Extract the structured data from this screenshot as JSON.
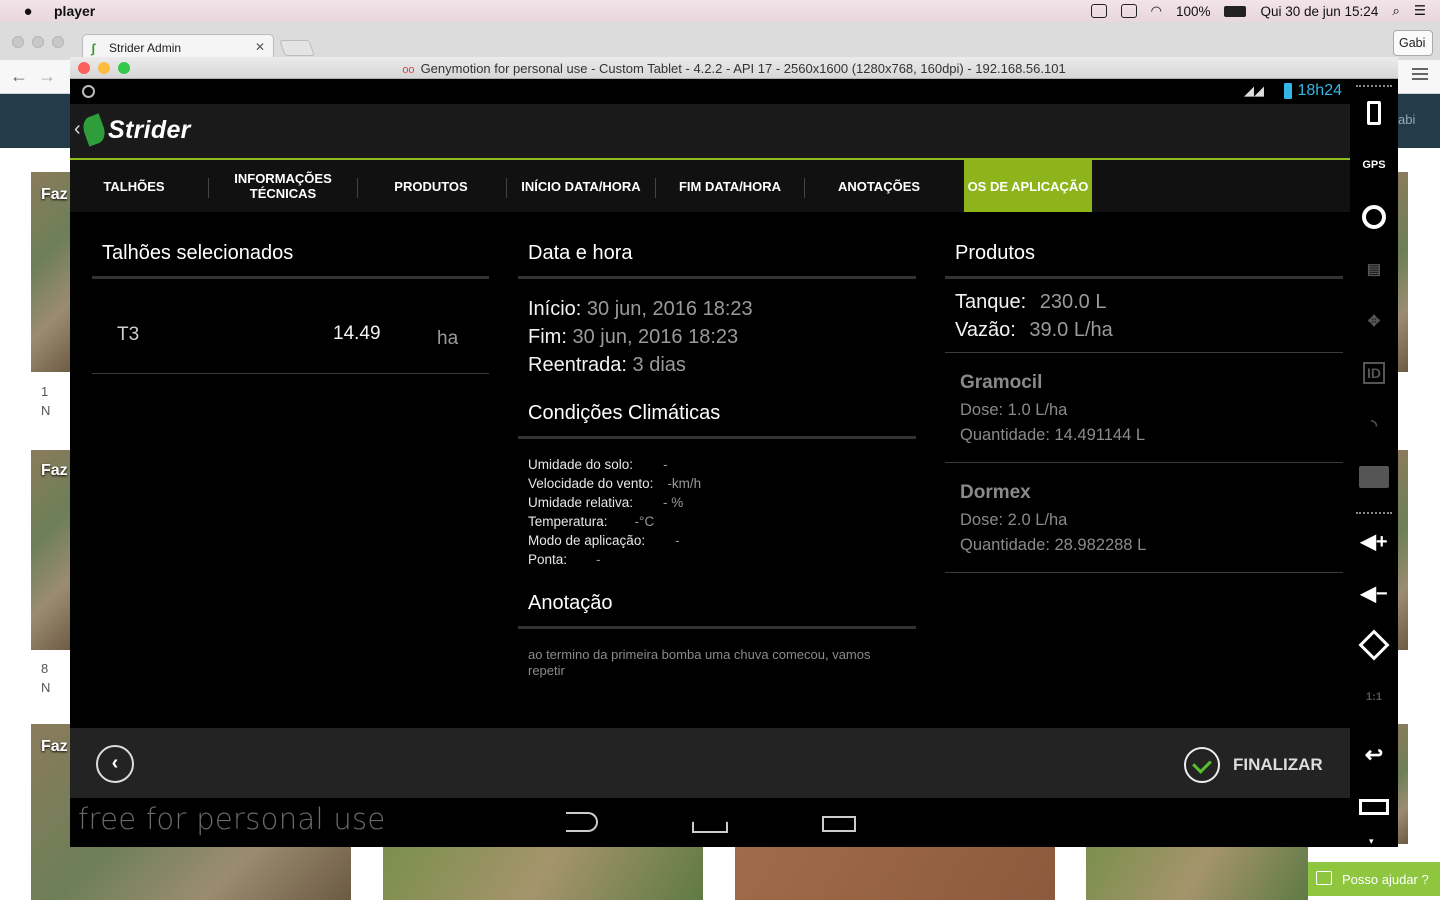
{
  "mac_menubar": {
    "app_name": "player",
    "battery_pct": "100%",
    "datetime": "Qui 30 de jun  15:24"
  },
  "browser": {
    "tab_title": "Strider Admin",
    "profile": "Gabi",
    "header_user_fragment": "abi",
    "help_button": "Posso ajudar ?",
    "cards": [
      {
        "label": "Faz",
        "meta1": "1",
        "meta2": "N"
      },
      {
        "label": "Faz",
        "meta1": "8",
        "meta2": "N"
      },
      {
        "label": "Faz"
      }
    ]
  },
  "genymotion": {
    "window_title": "Genymotion for personal use - Custom Tablet - 4.2.2 - API 17 - 2560x1600 (1280x768, 160dpi) - 192.168.56.101",
    "watermark": "free for personal use"
  },
  "android_status": {
    "time": "18h24"
  },
  "app": {
    "title": "Strider",
    "tabs": [
      {
        "label": "TALHÕES"
      },
      {
        "label": "INFORMAÇÕES TÉCNICAS"
      },
      {
        "label": "PRODUTOS"
      },
      {
        "label": "INÍCIO DATA/HORA"
      },
      {
        "label": "FIM DATA/HORA"
      },
      {
        "label": "ANOTAÇÕES"
      },
      {
        "label": "OS DE APLICAÇÃO"
      }
    ],
    "active_tab": "OS DE APLICAÇÃO",
    "talhoes": {
      "heading": "Talhões selecionados",
      "rows": [
        {
          "name": "T3",
          "area": "14.49",
          "unit": "ha"
        }
      ]
    },
    "data_hora": {
      "heading": "Data e hora",
      "inicio_label": "Início:",
      "inicio_value": "30 jun, 2016 18:23",
      "fim_label": "Fim:",
      "fim_value": "30 jun, 2016 18:23",
      "reentrada_label": "Reentrada:",
      "reentrada_value": "3 dias"
    },
    "clima": {
      "heading": "Condições Climáticas",
      "rows": [
        {
          "label": "Umidade do solo:",
          "value": "-"
        },
        {
          "label": "Velocidade do vento:",
          "value": "-km/h"
        },
        {
          "label": "Umidade relativa:",
          "value": "- %"
        },
        {
          "label": "Temperatura:",
          "value": "-°C"
        },
        {
          "label": "Modo de aplicação:",
          "value": "-"
        },
        {
          "label": "Ponta:",
          "value": "-"
        }
      ]
    },
    "anotacao": {
      "heading": "Anotação",
      "text": "ao termino da primeira bomba uma chuva comecou, vamos repetir"
    },
    "produtos": {
      "heading": "Produtos",
      "tanque_label": "Tanque:",
      "tanque_value": "230.0 L",
      "vazao_label": "Vazão:",
      "vazao_value": "39.0 L/ha",
      "items": [
        {
          "name": "Gramocil",
          "dose": "Dose: 1.0 L/ha",
          "quantidade": "Quantidade: 14.491144 L"
        },
        {
          "name": "Dormex",
          "dose": "Dose: 2.0 L/ha",
          "quantidade": "Quantidade: 28.982288 L"
        }
      ]
    },
    "finalize_label": "FINALIZAR"
  },
  "toolbar_icons": [
    "battery-icon",
    "gps-icon",
    "camera-icon",
    "media-icon",
    "move-icon",
    "id-icon",
    "rss-icon",
    "sms-icon",
    "volume-up-icon",
    "volume-down-icon",
    "rotate-icon",
    "scale-icon",
    "back-icon",
    "recent-apps-icon"
  ],
  "toolbar_text": {
    "gps": "GPS",
    "id": "ID",
    "scale": "1:1"
  },
  "colors": {
    "accent_green": "#8db51b",
    "status_blue": "#33b5e5",
    "check_green": "#5bbf2b"
  }
}
